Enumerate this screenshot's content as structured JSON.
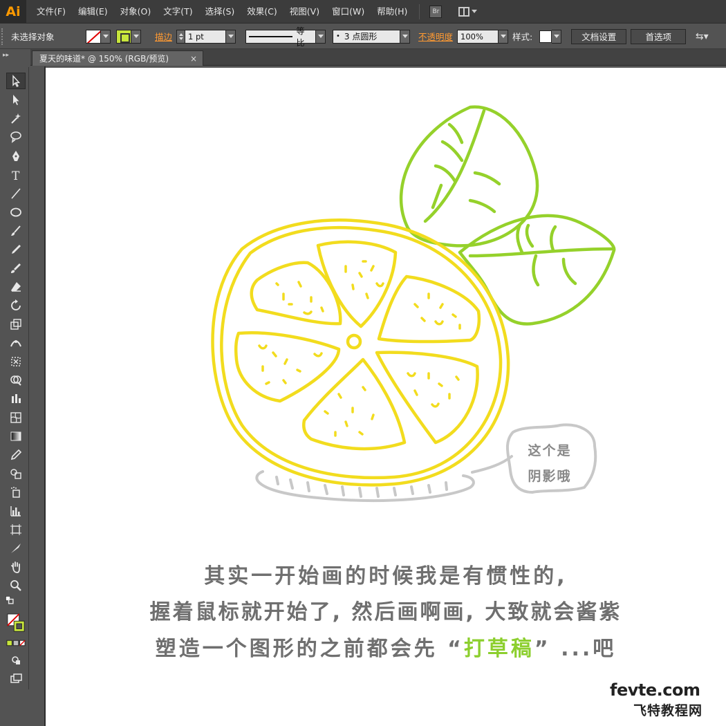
{
  "app": {
    "logo": "Ai",
    "menus": [
      "文件(F)",
      "编辑(E)",
      "对象(O)",
      "文字(T)",
      "选择(S)",
      "效果(C)",
      "视图(V)",
      "窗口(W)",
      "帮助(H)"
    ],
    "bridge_label": "Br"
  },
  "control": {
    "selection_status": "未选择对象",
    "stroke_label": "描边",
    "stroke_weight": "1 pt",
    "profile_label": "等比",
    "brush_label": "3 点圆形",
    "opacity_label": "不透明度",
    "opacity_value": "100%",
    "style_label": "样式:",
    "doc_setup_button": "文档设置",
    "preferences_button": "首选项"
  },
  "document": {
    "tab_title": "夏天的味道* @ 150% (RGB/预览)",
    "tab_close": "×"
  },
  "artwork": {
    "bubble_line1": "这个是",
    "bubble_line2": "阴影哦",
    "caption_line1": "其实一开始画的时候我是有惯性的,",
    "caption_line2": "握着鼠标就开始了, 然后画啊画, 大致就会酱紫",
    "caption_line3_pre": "塑造一个图形的之前都会先 “",
    "caption_line3_hl": "打草稿",
    "caption_line3_post": "” ...吧",
    "lemon_color": "#f2dc1e",
    "leaf_color": "#95d12b",
    "shadow_color": "#c8c8c8"
  },
  "watermark": {
    "line1": "fevte.com",
    "line2": "飞特教程网"
  }
}
